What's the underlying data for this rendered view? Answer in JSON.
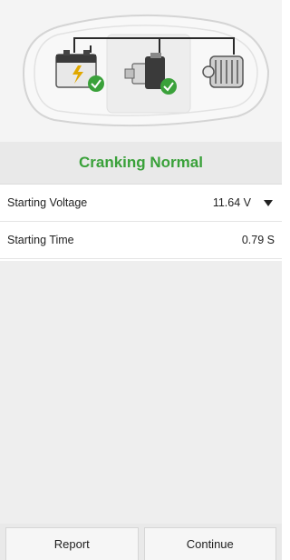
{
  "hero": {
    "illustration": "car-starting-circuit",
    "icons": [
      "battery-icon",
      "starter-motor-icon",
      "alternator-icon"
    ],
    "status_color": "#3aa13a"
  },
  "status": {
    "text": "Cranking Normal",
    "color": "#3aa13a"
  },
  "rows": [
    {
      "label": "Starting Voltage",
      "value": "11.64 V",
      "has_dropdown": true
    },
    {
      "label": "Starting Time",
      "value": "0.79 S",
      "has_dropdown": false
    }
  ],
  "footer": {
    "report_label": "Report",
    "continue_label": "Continue"
  }
}
